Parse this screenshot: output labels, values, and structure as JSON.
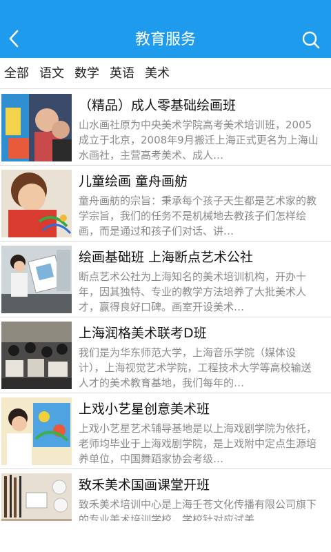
{
  "header": {
    "title": "教育服务",
    "accent_color": "#1e9bec",
    "back_icon": "chevron-left-icon",
    "search_icon": "search-icon"
  },
  "tabs": [
    {
      "label": "全部"
    },
    {
      "label": "语文"
    },
    {
      "label": "数学"
    },
    {
      "label": "英语"
    },
    {
      "label": "美术"
    }
  ],
  "items": [
    {
      "title": "（精品）成人零基础绘画班",
      "desc": "山水画社原为中央美术学院高考美术培训班，2005成立于北京，2008年9月搬迁上海正式更名为上海山水画社，主营高考美术、成人…"
    },
    {
      "title": "儿童绘画 童舟画舫",
      "desc": "童舟画舫的宗旨：秉承每个孩子天生都是艺术家的教学宗旨，我们的任务不是机械地去教孩子们怎样绘画，而是通过和孩子们对话、讲…"
    },
    {
      "title": "绘画基础班 上海断点艺术公社",
      "desc": "断点艺术公社为上海知名的美术培训机构，开办十年，因其独特、专业的教学方法培养了大批美术人才，赢得良好口碑。画室开设美术…"
    },
    {
      "title": "上海润格美术联考D班",
      "desc": "我们是为华东师范大学，上海音乐学院（媒体设计），上海视觉艺术学院，工程技术大学等高校输送人才的美术教育基地，我们每年的…"
    },
    {
      "title": "上戏小艺星创意美术班",
      "desc": "上戏小艺星艺术辅导基地是以上海戏剧学院为依托，老师均毕业于上海戏剧学院，是上戏附中定点生源培养单位，中国舞蹈家协会考级…"
    },
    {
      "title": "致禾美术国画课堂开班",
      "desc": "致禾美术培训中心是上海壬苍文化传播有限公司旗下的专业美术培训学校。学校针对应试美…"
    }
  ]
}
